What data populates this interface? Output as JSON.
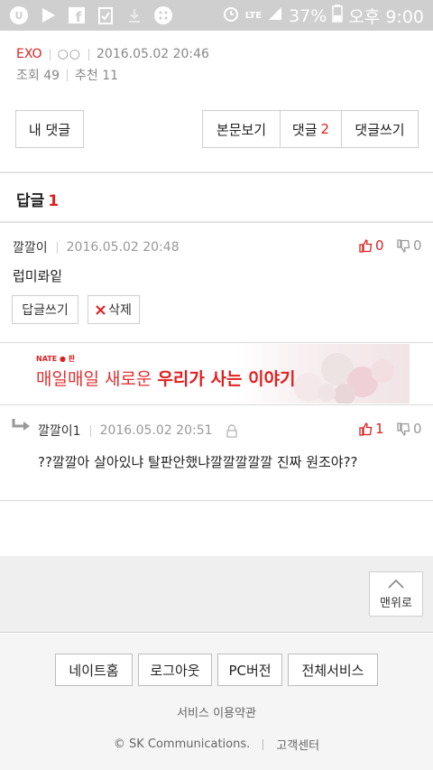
{
  "status_bar": {
    "network": "LTE",
    "battery": "37%",
    "time": "오후 9:00"
  },
  "post_meta": {
    "category": "EXO",
    "author": "○○",
    "datetime": "2016.05.02 20:46",
    "views": "조회 49",
    "recommend": "추천 11"
  },
  "actions": {
    "my_comments": "내 댓글",
    "view_body": "본문보기",
    "comments_label": "댓글",
    "comments_count": "2",
    "write_comment": "댓글쓰기"
  },
  "reply_section": {
    "title": "답글",
    "count": "1"
  },
  "comment": {
    "author": "깔깔이",
    "datetime": "2016.05.02 20:48",
    "up": "0",
    "down": "0",
    "text": "럽미롸잍",
    "reply_btn": "답글쓰기",
    "delete_btn": "삭제"
  },
  "ad": {
    "brand": "NATE ● 판",
    "text_normal": "매일매일 새로운 ",
    "text_bold": "우리가 사는 이야기."
  },
  "reply": {
    "author": "깔깔이1",
    "datetime": "2016.05.02 20:51",
    "up": "1",
    "down": "0",
    "text": "??깔깔아 살아있냐 탈판안했냐깔깔깔깔깔 진짜 원조야??"
  },
  "to_top": "맨위로",
  "footer": {
    "links": [
      "네이트홈",
      "로그아웃",
      "PC버전",
      "전체서비스"
    ],
    "terms": "서비스 이용약관",
    "copyright": "© SK Communications.",
    "support": "고객센터"
  },
  "colors": {
    "accent_red": "#e02020",
    "status_bar_bg": "#cfcfcf",
    "footer_bg": "#f5f5f5"
  }
}
